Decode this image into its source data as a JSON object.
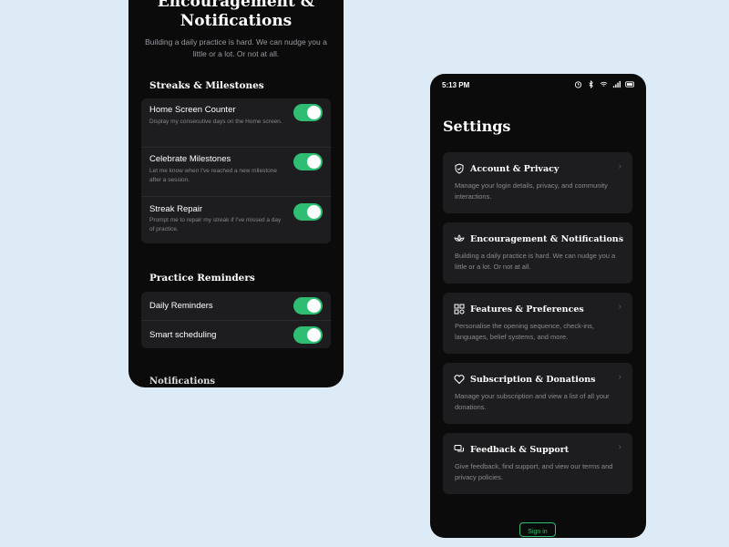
{
  "left_screen": {
    "title": "Encouragement & Notifications",
    "subtitle": "Building a daily practice is hard. We can nudge you a little or a lot. Or not at all.",
    "sections": [
      {
        "heading": "Streaks & Milestones",
        "rows": [
          {
            "title": "Home Screen Counter",
            "description": "Display my consecutive days on the Home screen.",
            "enabled": true
          },
          {
            "title": "Celebrate Milestones",
            "description": "Let me know when I've reached a new milestone after a session.",
            "enabled": true
          },
          {
            "title": "Streak Repair",
            "description": "Prompt me to repair my streak if I've missed a day of practice.",
            "enabled": true
          }
        ]
      },
      {
        "heading": "Practice Reminders",
        "rows": [
          {
            "title": "Daily Reminders",
            "enabled": true
          },
          {
            "title": "Smart scheduling",
            "enabled": true
          }
        ]
      }
    ],
    "peek_heading": "Notifications"
  },
  "right_screen": {
    "status_time": "5:13 PM",
    "status_icons": [
      "alarm-icon",
      "bluetooth-icon",
      "wifi-icon",
      "signal-icon",
      "battery-icon"
    ],
    "title": "Settings",
    "items": [
      {
        "icon": "shield-icon",
        "title": "Account & Privacy",
        "description": "Manage your login details, privacy, and community interactions."
      },
      {
        "icon": "lotus-icon",
        "title": "Encouragement & Notifications",
        "description": "Building a daily practice is hard. We can nudge you a little or a lot. Or not at all."
      },
      {
        "icon": "grid-icon",
        "title": "Features & Preferences",
        "description": "Personalise the opening sequence, check-ins, languages, belief systems, and more."
      },
      {
        "icon": "heart-icon",
        "title": "Subscription & Donations",
        "description": "Manage your subscription and view a list of all your donations."
      },
      {
        "icon": "chat-icon",
        "title": "Feedback & Support",
        "description": "Give feedback, find support, and view our terms and privacy policies."
      }
    ],
    "signin_label": "Sign in"
  },
  "colors": {
    "background": "#dcebf5",
    "toggle_on": "#2fbd73",
    "card": "#1d1d20",
    "screen": "#0b0b0c"
  }
}
